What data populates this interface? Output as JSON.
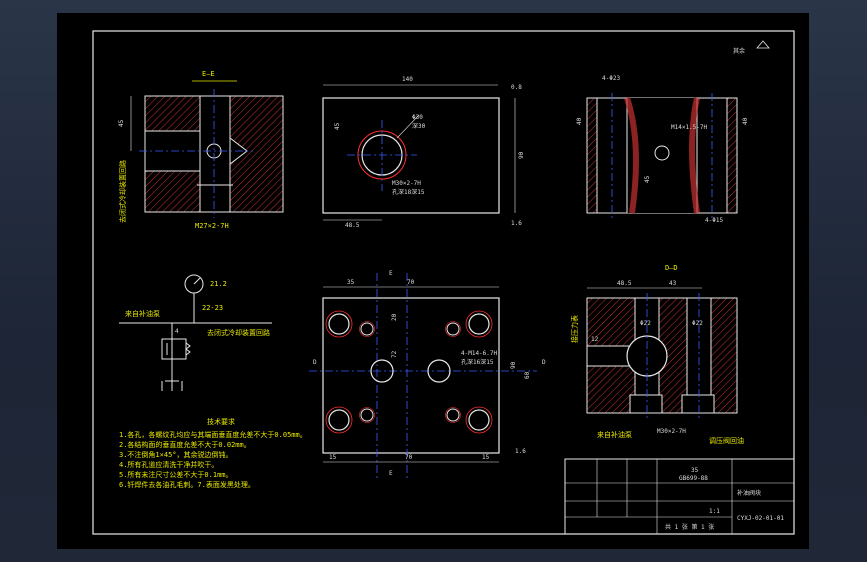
{
  "views": {
    "section_ee": {
      "title": "E—E",
      "dim_height": "45",
      "thread": "M27×2-7H",
      "note": "去闭式冷却装置回路"
    },
    "top": {
      "dim_width": "140",
      "dim_height": "90",
      "dim_depth": "45",
      "dim_offset": "48.5",
      "leader_a": "Φ30",
      "leader_b": "深30",
      "thread": "M30×2-7H",
      "thread_depth": "孔深18深15",
      "finish": "1.6",
      "roughness": "0.8"
    },
    "side": {
      "top_holes": "4-Φ23",
      "thread": "M14×1.5-7H",
      "dim_left": "40",
      "dim_right": "40",
      "dim_mid": "45",
      "bottom_holes": "4-Φ15"
    },
    "plan": {
      "marker_e": "E",
      "marker_d": "D",
      "dim_35": "35",
      "dim_70_top": "70",
      "dim_20": "20",
      "dim_72": "72",
      "dim_90": "90",
      "dim_60": "60",
      "dim_15a": "15",
      "dim_70_bottom": "70",
      "dim_15b": "15",
      "holes": "4-M14-6.7H",
      "hole_depth": "孔深16深15",
      "finish": "1.6"
    },
    "section_dd": {
      "title": "D—D",
      "dim_485": "48.5",
      "dim_43": "43",
      "dia_left": "Φ22",
      "dia_right": "Φ22",
      "dim_12": "12",
      "label_top": "接压力表",
      "label_bottom": "来自补油泵",
      "thread": "M30×2-7H",
      "label_right": "调压阀回油"
    }
  },
  "schematic": {
    "gauge_top": "21.2",
    "gauge_bottom": "22-23",
    "line_left": "来自补油泵",
    "port": "4",
    "line_right": "去闭式冷却装置回路"
  },
  "tech_req": {
    "title": "技术要求",
    "lines": [
      "1.各孔，各螺纹孔均应与其端面垂直度允差不大于0.05mm。",
      "2.各结构面的垂直度允差不大于0.02mm。",
      "3.不注倒角1×45°，其余锐边倒钝。",
      "4.所有孔道应清洗干净并吹干。",
      "5.所有未注尺寸公差不大于0.1mm。",
      "6.钎焊件去各油孔毛刺。7.表面发黑处理。"
    ]
  },
  "roughness_top": "其余",
  "title_block": {
    "material": "35",
    "standard": "GB699-88",
    "part_name": "补油阀块",
    "drawing_no": "CYXJ-02-01-01",
    "scale": "1:1",
    "sheet": "共 1 张 第 1 张"
  }
}
